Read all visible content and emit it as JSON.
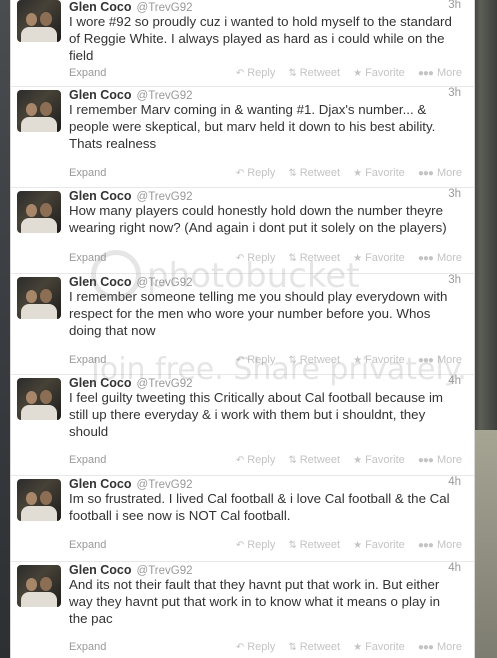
{
  "tweets": [
    {
      "name": "Glen Coco",
      "handle": "@TrevG92",
      "time": "3h",
      "text": "I wore #92 so proudly cuz i wanted to hold myself to the standard of Reggie White. I always played as hard as i could while on the field"
    },
    {
      "name": "Glen Coco",
      "handle": "@TrevG92",
      "time": "3h",
      "text": "I remember Marv coming in & wanting #1. Djax's number... & people were skeptical, but marv held it down to his best ability. Thats realness"
    },
    {
      "name": "Glen Coco",
      "handle": "@TrevG92",
      "time": "3h",
      "text": "How many players could honestly hold down the number theyre wearing right now? (And again i dont put it solely on the players)"
    },
    {
      "name": "Glen Coco",
      "handle": "@TrevG92",
      "time": "3h",
      "text": "I remember someone telling me you should play everydown with respect for the men who wore your number before you. Whos doing that now"
    },
    {
      "name": "Glen Coco",
      "handle": "@TrevG92",
      "time": "4h",
      "text": "I feel guilty tweeting this Critically about Cal football because im still up there everyday & i work with them but i shouldnt, they should"
    },
    {
      "name": "Glen Coco",
      "handle": "@TrevG92",
      "time": "4h",
      "text": "Im so frustrated. I lived Cal football & i love Cal football & the Cal football i see now is NOT Cal football."
    },
    {
      "name": "Glen Coco",
      "handle": "@TrevG92",
      "time": "4h",
      "text": "And its not their fault that they havnt put that work in. But either way they havnt put that work in to know what it means o play in the pac"
    }
  ],
  "labels": {
    "expand": "Expand",
    "reply": "Reply",
    "retweet": "Retweet",
    "favorite": "Favorite",
    "more": "More"
  },
  "icons": {
    "reply": "reply-icon",
    "retweet": "retweet-icon",
    "favorite": "star-icon",
    "more": "more-dots-icon"
  },
  "watermark": {
    "brand": "photobucket",
    "tagline": "Join free. Share privately."
  },
  "colors": {
    "name": "#333333",
    "meta": "#999999",
    "action": "#c4c4c4",
    "divider": "#e8e8e8"
  }
}
